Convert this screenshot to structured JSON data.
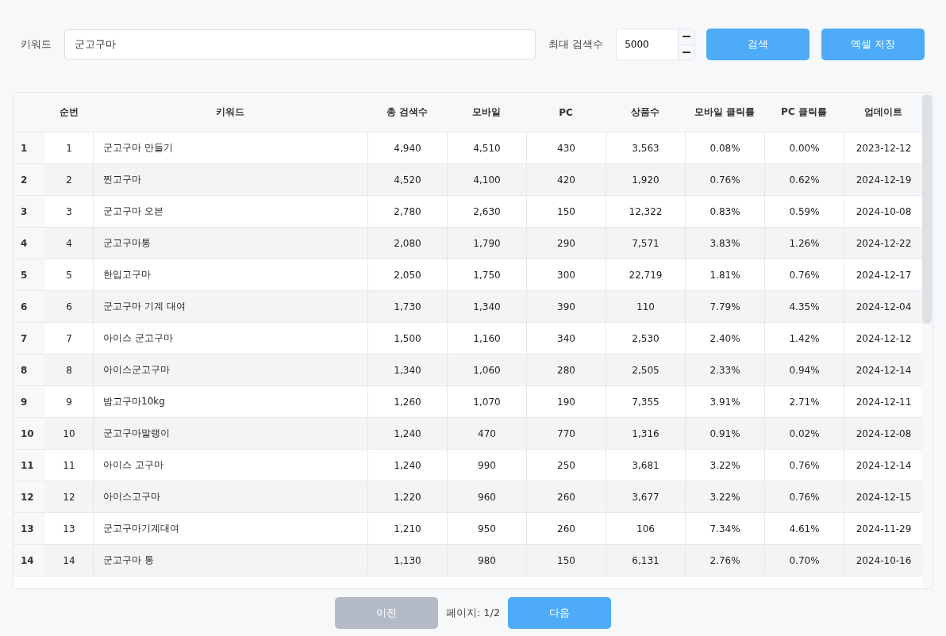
{
  "search_bar": {
    "keyword_label": "키워드",
    "keyword_value": "군고구마",
    "max_label": "최대 검색수",
    "max_value": "5000",
    "buttons": [
      {
        "label": "검색",
        "disabled": false
      },
      {
        "label": "엑셀 저장",
        "disabled": false
      }
    ]
  },
  "table": {
    "columns": [
      "순번",
      "키워드",
      "총 검색수",
      "모바일",
      "PC",
      "상품수",
      "모바일 클릭률",
      "PC 클릭률",
      "업데이트"
    ],
    "rows": [
      {
        "index": "1",
        "cells": [
          "1",
          "군고구마 만들기",
          "4,940",
          "4,510",
          "430",
          "3,563",
          "0.08%",
          "0.00%",
          "2023-12-12"
        ]
      },
      {
        "index": "2",
        "cells": [
          "2",
          "찐고구마",
          "4,520",
          "4,100",
          "420",
          "1,920",
          "0.76%",
          "0.62%",
          "2024-12-19"
        ]
      },
      {
        "index": "3",
        "cells": [
          "3",
          "군고구마 오븐",
          "2,780",
          "2,630",
          "150",
          "12,322",
          "0.83%",
          "0.59%",
          "2024-10-08"
        ]
      },
      {
        "index": "4",
        "cells": [
          "4",
          "군고구마통",
          "2,080",
          "1,790",
          "290",
          "7,571",
          "3.83%",
          "1.26%",
          "2024-12-22"
        ]
      },
      {
        "index": "5",
        "cells": [
          "5",
          "한입고구마",
          "2,050",
          "1,750",
          "300",
          "22,719",
          "1.81%",
          "0.76%",
          "2024-12-17"
        ]
      },
      {
        "index": "6",
        "cells": [
          "6",
          "군고구마 기계 대여",
          "1,730",
          "1,340",
          "390",
          "110",
          "7.79%",
          "4.35%",
          "2024-12-04"
        ]
      },
      {
        "index": "7",
        "cells": [
          "7",
          "아이스 군고구마",
          "1,500",
          "1,160",
          "340",
          "2,530",
          "2.40%",
          "1.42%",
          "2024-12-12"
        ]
      },
      {
        "index": "8",
        "cells": [
          "8",
          "아이스군고구마",
          "1,340",
          "1,060",
          "280",
          "2,505",
          "2.33%",
          "0.94%",
          "2024-12-14"
        ]
      },
      {
        "index": "9",
        "cells": [
          "9",
          "밤고구마10kg",
          "1,260",
          "1,070",
          "190",
          "7,355",
          "3.91%",
          "2.71%",
          "2024-12-11"
        ]
      },
      {
        "index": "10",
        "cells": [
          "10",
          "군고구마말랭이",
          "1,240",
          "470",
          "770",
          "1,316",
          "0.91%",
          "0.02%",
          "2024-12-08"
        ]
      },
      {
        "index": "11",
        "cells": [
          "11",
          "아이스 고구마",
          "1,240",
          "990",
          "250",
          "3,681",
          "3.22%",
          "0.76%",
          "2024-12-14"
        ]
      },
      {
        "index": "12",
        "cells": [
          "12",
          "아이스고구마",
          "1,220",
          "960",
          "260",
          "3,677",
          "3.22%",
          "0.76%",
          "2024-12-15"
        ]
      },
      {
        "index": "13",
        "cells": [
          "13",
          "군고구마기계대여",
          "1,210",
          "950",
          "260",
          "106",
          "7.34%",
          "4.61%",
          "2024-11-29"
        ]
      },
      {
        "index": "14",
        "cells": [
          "14",
          "군고구마 통",
          "1,130",
          "980",
          "150",
          "6,131",
          "2.76%",
          "0.70%",
          "2024-10-16"
        ]
      }
    ]
  },
  "pagination": {
    "prev": {
      "label": "이전",
      "disabled": true
    },
    "page_text": "페이지: 1/2",
    "next": {
      "label": "다음",
      "disabled": false
    }
  }
}
